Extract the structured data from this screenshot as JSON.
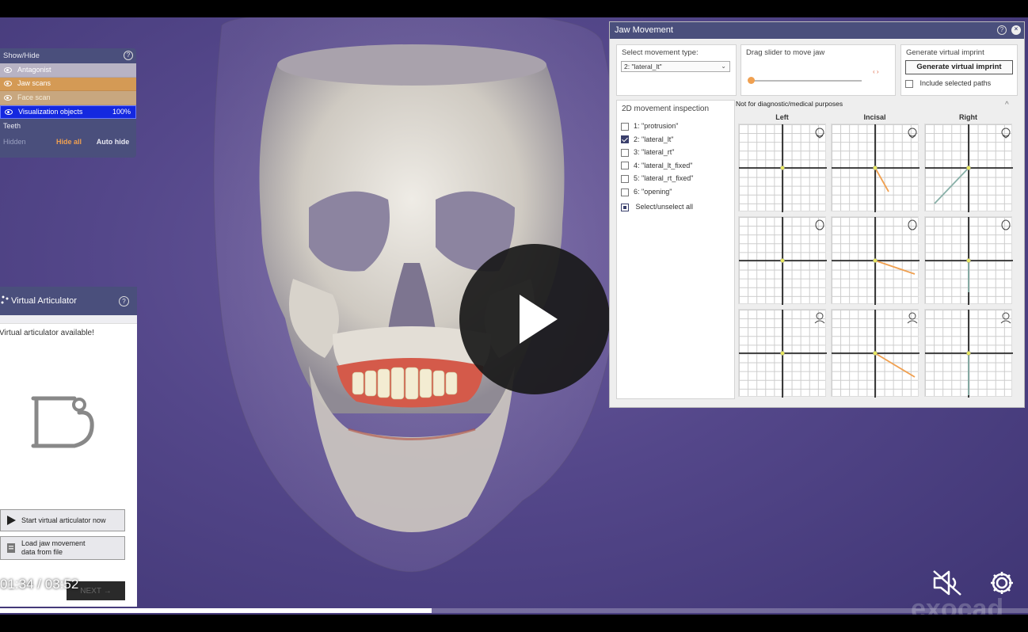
{
  "show_hide": {
    "title": "Show/Hide",
    "rows": [
      {
        "label": "Antagonist"
      },
      {
        "label": "Jaw scans"
      },
      {
        "label": "Face scan"
      },
      {
        "label": "Visualization objects",
        "value": "100%"
      }
    ],
    "teeth": "Teeth",
    "hidden": "Hidden",
    "hide_all": "Hide all",
    "auto_hide": "Auto hide"
  },
  "virtual_articulator": {
    "title": "Virtual Articulator",
    "available": "Virtual articulator available!",
    "start_btn": "Start virtual articulator now",
    "load_btn_line1": "Load jaw movement",
    "load_btn_line2": "data from file",
    "next_btn": "NEXT"
  },
  "player": {
    "current_time": "01:34",
    "separator": "/",
    "duration": "03:52",
    "progress": 0.42,
    "watermark": "exocad"
  },
  "jaw_movement": {
    "title": "Jaw Movement",
    "select_label": "Select movement type:",
    "select_value": "2: \"lateral_lt\"",
    "slider_label": "Drag slider to move jaw",
    "slider_value": 0,
    "gen_label": "Generate virtual imprint",
    "gen_btn": "Generate virtual imprint",
    "include_paths": "Include selected paths",
    "inspection_title": "2D movement inspection",
    "disclaimer": "Not for diagnostic/medical purposes",
    "movements": [
      {
        "label": "1: \"protrusion\"",
        "checked": false
      },
      {
        "label": "2: \"lateral_lt\"",
        "checked": true
      },
      {
        "label": "3: \"lateral_rt\"",
        "checked": false
      },
      {
        "label": "4: \"lateral_lt_fixed\"",
        "checked": false
      },
      {
        "label": "5: \"lateral_rt_fixed\"",
        "checked": false
      },
      {
        "label": "6: \"opening\"",
        "checked": false
      }
    ],
    "select_all": "Select/unselect all",
    "columns": [
      "Left",
      "Incisal",
      "Right"
    ],
    "path_color": "#f0a050",
    "path_color_alt": "#88b0a8"
  }
}
